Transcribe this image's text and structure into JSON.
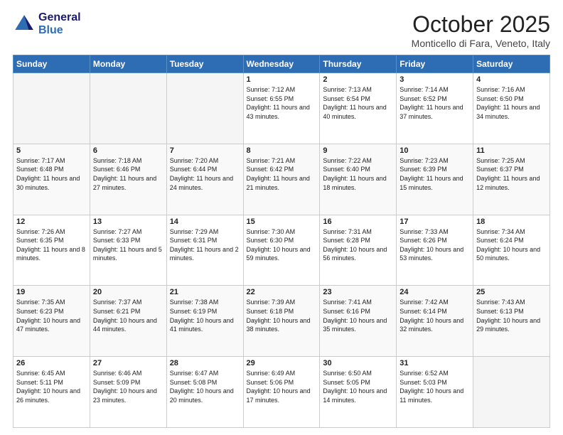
{
  "header": {
    "logo_line1": "General",
    "logo_line2": "Blue",
    "month_title": "October 2025",
    "location": "Monticello di Fara, Veneto, Italy"
  },
  "days_of_week": [
    "Sunday",
    "Monday",
    "Tuesday",
    "Wednesday",
    "Thursday",
    "Friday",
    "Saturday"
  ],
  "weeks": [
    [
      {
        "day": "",
        "text": ""
      },
      {
        "day": "",
        "text": ""
      },
      {
        "day": "",
        "text": ""
      },
      {
        "day": "1",
        "text": "Sunrise: 7:12 AM\nSunset: 6:55 PM\nDaylight: 11 hours and 43 minutes."
      },
      {
        "day": "2",
        "text": "Sunrise: 7:13 AM\nSunset: 6:54 PM\nDaylight: 11 hours and 40 minutes."
      },
      {
        "day": "3",
        "text": "Sunrise: 7:14 AM\nSunset: 6:52 PM\nDaylight: 11 hours and 37 minutes."
      },
      {
        "day": "4",
        "text": "Sunrise: 7:16 AM\nSunset: 6:50 PM\nDaylight: 11 hours and 34 minutes."
      }
    ],
    [
      {
        "day": "5",
        "text": "Sunrise: 7:17 AM\nSunset: 6:48 PM\nDaylight: 11 hours and 30 minutes."
      },
      {
        "day": "6",
        "text": "Sunrise: 7:18 AM\nSunset: 6:46 PM\nDaylight: 11 hours and 27 minutes."
      },
      {
        "day": "7",
        "text": "Sunrise: 7:20 AM\nSunset: 6:44 PM\nDaylight: 11 hours and 24 minutes."
      },
      {
        "day": "8",
        "text": "Sunrise: 7:21 AM\nSunset: 6:42 PM\nDaylight: 11 hours and 21 minutes."
      },
      {
        "day": "9",
        "text": "Sunrise: 7:22 AM\nSunset: 6:40 PM\nDaylight: 11 hours and 18 minutes."
      },
      {
        "day": "10",
        "text": "Sunrise: 7:23 AM\nSunset: 6:39 PM\nDaylight: 11 hours and 15 minutes."
      },
      {
        "day": "11",
        "text": "Sunrise: 7:25 AM\nSunset: 6:37 PM\nDaylight: 11 hours and 12 minutes."
      }
    ],
    [
      {
        "day": "12",
        "text": "Sunrise: 7:26 AM\nSunset: 6:35 PM\nDaylight: 11 hours and 8 minutes."
      },
      {
        "day": "13",
        "text": "Sunrise: 7:27 AM\nSunset: 6:33 PM\nDaylight: 11 hours and 5 minutes."
      },
      {
        "day": "14",
        "text": "Sunrise: 7:29 AM\nSunset: 6:31 PM\nDaylight: 11 hours and 2 minutes."
      },
      {
        "day": "15",
        "text": "Sunrise: 7:30 AM\nSunset: 6:30 PM\nDaylight: 10 hours and 59 minutes."
      },
      {
        "day": "16",
        "text": "Sunrise: 7:31 AM\nSunset: 6:28 PM\nDaylight: 10 hours and 56 minutes."
      },
      {
        "day": "17",
        "text": "Sunrise: 7:33 AM\nSunset: 6:26 PM\nDaylight: 10 hours and 53 minutes."
      },
      {
        "day": "18",
        "text": "Sunrise: 7:34 AM\nSunset: 6:24 PM\nDaylight: 10 hours and 50 minutes."
      }
    ],
    [
      {
        "day": "19",
        "text": "Sunrise: 7:35 AM\nSunset: 6:23 PM\nDaylight: 10 hours and 47 minutes."
      },
      {
        "day": "20",
        "text": "Sunrise: 7:37 AM\nSunset: 6:21 PM\nDaylight: 10 hours and 44 minutes."
      },
      {
        "day": "21",
        "text": "Sunrise: 7:38 AM\nSunset: 6:19 PM\nDaylight: 10 hours and 41 minutes."
      },
      {
        "day": "22",
        "text": "Sunrise: 7:39 AM\nSunset: 6:18 PM\nDaylight: 10 hours and 38 minutes."
      },
      {
        "day": "23",
        "text": "Sunrise: 7:41 AM\nSunset: 6:16 PM\nDaylight: 10 hours and 35 minutes."
      },
      {
        "day": "24",
        "text": "Sunrise: 7:42 AM\nSunset: 6:14 PM\nDaylight: 10 hours and 32 minutes."
      },
      {
        "day": "25",
        "text": "Sunrise: 7:43 AM\nSunset: 6:13 PM\nDaylight: 10 hours and 29 minutes."
      }
    ],
    [
      {
        "day": "26",
        "text": "Sunrise: 6:45 AM\nSunset: 5:11 PM\nDaylight: 10 hours and 26 minutes."
      },
      {
        "day": "27",
        "text": "Sunrise: 6:46 AM\nSunset: 5:09 PM\nDaylight: 10 hours and 23 minutes."
      },
      {
        "day": "28",
        "text": "Sunrise: 6:47 AM\nSunset: 5:08 PM\nDaylight: 10 hours and 20 minutes."
      },
      {
        "day": "29",
        "text": "Sunrise: 6:49 AM\nSunset: 5:06 PM\nDaylight: 10 hours and 17 minutes."
      },
      {
        "day": "30",
        "text": "Sunrise: 6:50 AM\nSunset: 5:05 PM\nDaylight: 10 hours and 14 minutes."
      },
      {
        "day": "31",
        "text": "Sunrise: 6:52 AM\nSunset: 5:03 PM\nDaylight: 10 hours and 11 minutes."
      },
      {
        "day": "",
        "text": ""
      }
    ]
  ]
}
